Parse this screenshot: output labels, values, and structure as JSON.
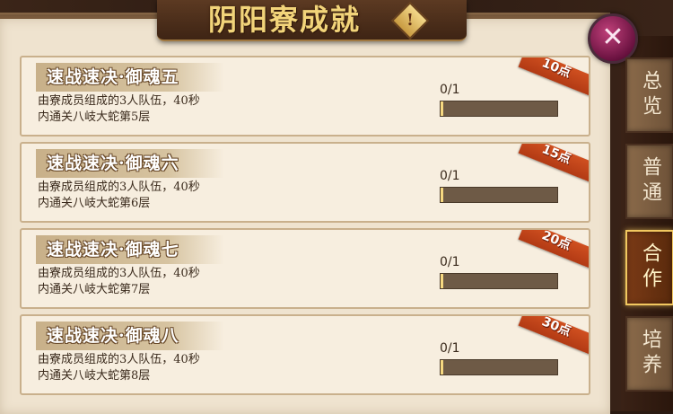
{
  "title": "阴阳寮成就",
  "info_symbol": "!",
  "close_symbol": "✕",
  "tabs": [
    {
      "label": "总览",
      "active": false
    },
    {
      "label": "普通",
      "active": false
    },
    {
      "label": "合作",
      "active": true
    },
    {
      "label": "培养",
      "active": false
    }
  ],
  "achievements": [
    {
      "title": "速战速决·御魂五",
      "desc_line1": "由寮成员组成的3人队伍，40秒",
      "desc_line2": "内通关八岐大蛇第5层",
      "progress": "0/1",
      "progress_fraction": 0,
      "points": "10点"
    },
    {
      "title": "速战速决·御魂六",
      "desc_line1": "由寮成员组成的3人队伍，40秒",
      "desc_line2": "内通关八岐大蛇第6层",
      "progress": "0/1",
      "progress_fraction": 0,
      "points": "15点"
    },
    {
      "title": "速战速决·御魂七",
      "desc_line1": "由寮成员组成的3人队伍，40秒",
      "desc_line2": "内通关八岐大蛇第7层",
      "progress": "0/1",
      "progress_fraction": 0,
      "points": "20点"
    },
    {
      "title": "速战速决·御魂八",
      "desc_line1": "由寮成员组成的3人队伍，40秒",
      "desc_line2": "内通关八岐大蛇第8层",
      "progress": "0/1",
      "progress_fraction": 0,
      "points": "30点"
    }
  ],
  "icons": {
    "info": "info-diamond-icon",
    "close": "close-icon"
  },
  "colors": {
    "ribbon": "#c0461a",
    "active_tab_border": "#f2c860",
    "title_gold": "#f2d47a"
  }
}
